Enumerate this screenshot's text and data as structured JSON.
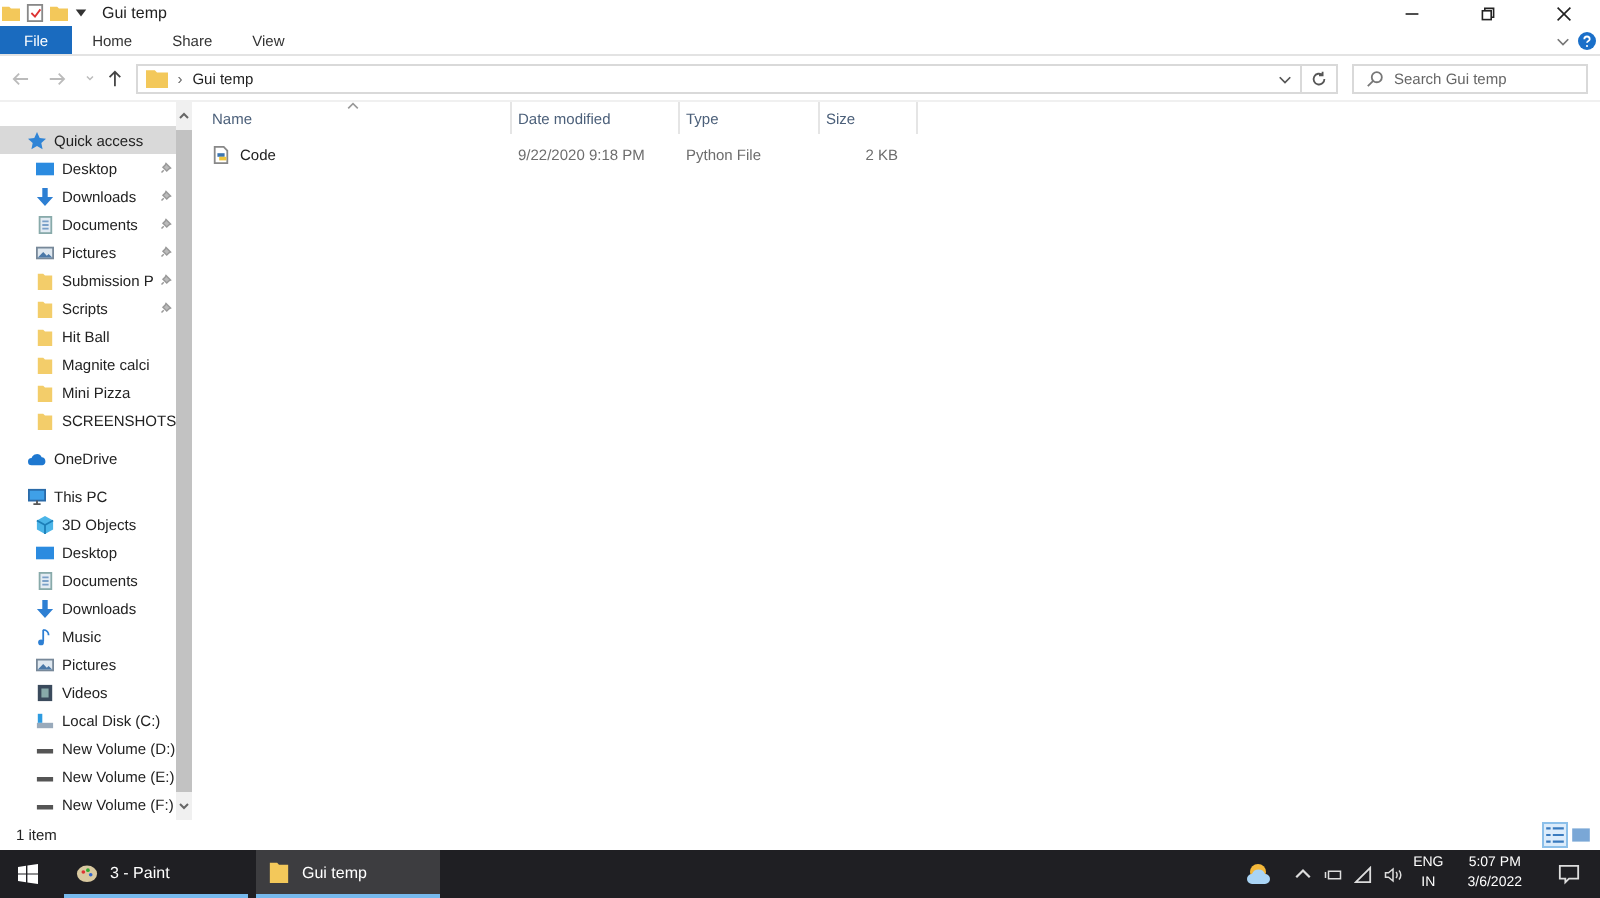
{
  "window": {
    "title": "Gui temp"
  },
  "ribbon_tabs": [
    {
      "label": "File",
      "selected": true
    },
    {
      "label": "Home",
      "selected": false
    },
    {
      "label": "Share",
      "selected": false
    },
    {
      "label": "View",
      "selected": false
    }
  ],
  "address_bar": {
    "separator": "›",
    "path": "Gui temp"
  },
  "search": {
    "placeholder": "Search Gui temp"
  },
  "sidebar": {
    "groups": [
      {
        "label": "Quick access",
        "kind": "star",
        "selected": true,
        "children": [
          {
            "label": "Desktop",
            "kind": "desktop",
            "pinned": true,
            "selected": false
          },
          {
            "label": "Downloads",
            "kind": "download",
            "pinned": true,
            "selected": false
          },
          {
            "label": "Documents",
            "kind": "document",
            "pinned": true,
            "selected": false
          },
          {
            "label": "Pictures",
            "kind": "picture",
            "pinned": true,
            "selected": false
          },
          {
            "label": "Submission P",
            "kind": "folder",
            "pinned": true,
            "selected": false
          },
          {
            "label": "Scripts",
            "kind": "folder",
            "pinned": true,
            "selected": false
          },
          {
            "label": "Hit Ball",
            "kind": "folder",
            "pinned": false,
            "selected": false
          },
          {
            "label": "Magnite calci",
            "kind": "folder",
            "pinned": false,
            "selected": false
          },
          {
            "label": "Mini Pizza",
            "kind": "folder",
            "pinned": false,
            "selected": false
          },
          {
            "label": "SCREENSHOTS",
            "kind": "folder",
            "pinned": false,
            "selected": false
          }
        ]
      },
      {
        "label": "OneDrive",
        "kind": "cloud",
        "selected": false
      },
      {
        "label": "This PC",
        "kind": "monitor",
        "selected": false,
        "children": [
          {
            "label": "3D Objects",
            "kind": "cube",
            "pinned": false,
            "selected": false
          },
          {
            "label": "Desktop",
            "kind": "desktop",
            "pinned": false,
            "selected": false
          },
          {
            "label": "Documents",
            "kind": "document",
            "pinned": false,
            "selected": false
          },
          {
            "label": "Downloads",
            "kind": "download",
            "pinned": false,
            "selected": false
          },
          {
            "label": "Music",
            "kind": "music",
            "pinned": false,
            "selected": false
          },
          {
            "label": "Pictures",
            "kind": "picture",
            "pinned": false,
            "selected": false
          },
          {
            "label": "Videos",
            "kind": "video",
            "pinned": false,
            "selected": false
          },
          {
            "label": "Local Disk (C:)",
            "kind": "disk",
            "pinned": false,
            "selected": false
          },
          {
            "label": "New Volume (D:)",
            "kind": "drive",
            "pinned": false,
            "selected": false
          },
          {
            "label": "New Volume (E:)",
            "kind": "drive",
            "pinned": false,
            "selected": false
          },
          {
            "label": "New Volume (F:)",
            "kind": "drive",
            "pinned": false,
            "selected": false
          }
        ]
      }
    ]
  },
  "table": {
    "columns": [
      "Name",
      "Date modified",
      "Type",
      "Size"
    ],
    "rows": [
      {
        "name": "Code",
        "date_modified": "9/22/2020 9:18 PM",
        "type": "Python File",
        "size": "2 KB",
        "selected": false
      }
    ]
  },
  "status_bar": {
    "item_count": "1 item"
  },
  "taskbar": {
    "apps": [
      {
        "label": "3 - Paint",
        "kind": "paint",
        "selected": false
      },
      {
        "label": "Gui temp",
        "kind": "folder",
        "selected": true
      }
    ],
    "language": "ENG",
    "region": "IN",
    "time": "5:07 PM",
    "date": "3/6/2022"
  }
}
